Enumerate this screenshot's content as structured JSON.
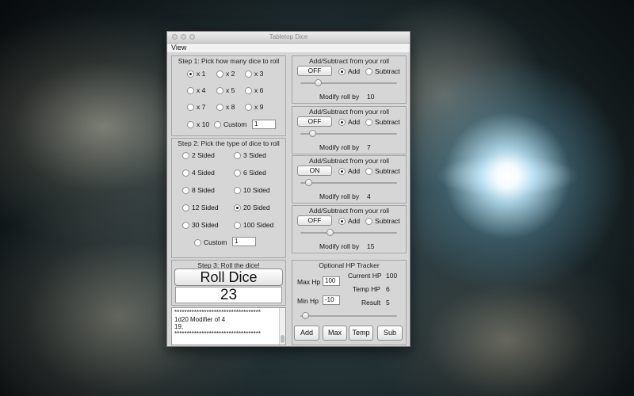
{
  "window": {
    "title": "Tabletop Dice"
  },
  "menu": {
    "view": "View"
  },
  "step1": {
    "title": "Step 1: Pick how many dice to roll",
    "options": [
      "x 1",
      "x 2",
      "x 3",
      "x 4",
      "x 5",
      "x 6",
      "x 7",
      "x 8",
      "x 9",
      "x 10"
    ],
    "selected": "x 1",
    "custom_label": "Custom",
    "custom_value": "1"
  },
  "step2": {
    "title": "Step 2: Pick the type of dice to roll",
    "options": [
      "2 Sided",
      "3 Sided",
      "4 Sided",
      "6 Sided",
      "8 Sided",
      "10 Sided",
      "12 Sided",
      "20 Sided",
      "30 Sided",
      "100 Sided"
    ],
    "selected": "20 Sided",
    "custom_label": "Custom",
    "custom_value": "1"
  },
  "step3": {
    "title": "Step 3: Roll the dice!",
    "roll_button": "Roll Dice",
    "result": "23",
    "log": [
      "***********************************",
      "1d20 Modifier of 4",
      "19,",
      "***********************************"
    ]
  },
  "modifiers": [
    {
      "title": "Add/Subtract from your roll",
      "toggle": "OFF",
      "add_label": "Add",
      "subtract_label": "Subtract",
      "mode": "Add",
      "modify_label": "Modify roll by",
      "value": "10",
      "slider_fraction": 0.18
    },
    {
      "title": "Add/Subtract from your roll",
      "toggle": "OFF",
      "add_label": "Add",
      "subtract_label": "Subtract",
      "mode": "Add",
      "modify_label": "Modify roll by",
      "value": "7",
      "slider_fraction": 0.12
    },
    {
      "title": "Add/Subtract from your roll",
      "toggle": "ON",
      "add_label": "Add",
      "subtract_label": "Subtract",
      "mode": "Add",
      "modify_label": "Modify roll by",
      "value": "4",
      "slider_fraction": 0.08
    },
    {
      "title": "Add/Subtract from your roll",
      "toggle": "OFF",
      "add_label": "Add",
      "subtract_label": "Subtract",
      "mode": "Add",
      "modify_label": "Modify roll by",
      "value": "15",
      "slider_fraction": 0.3
    }
  ],
  "hp": {
    "title": "Optional HP Tracker",
    "max_label": "Max Hp",
    "max_value": "100",
    "min_label": "Min Hp",
    "min_value": "-10",
    "current_label": "Current HP",
    "current_value": "100",
    "temp_label": "Temp HP",
    "temp_value": "6",
    "result_label": "Result",
    "result_value": "5",
    "slider_fraction": 0.05,
    "buttons": [
      "Add",
      "Max",
      "Temp",
      "Sub"
    ]
  }
}
